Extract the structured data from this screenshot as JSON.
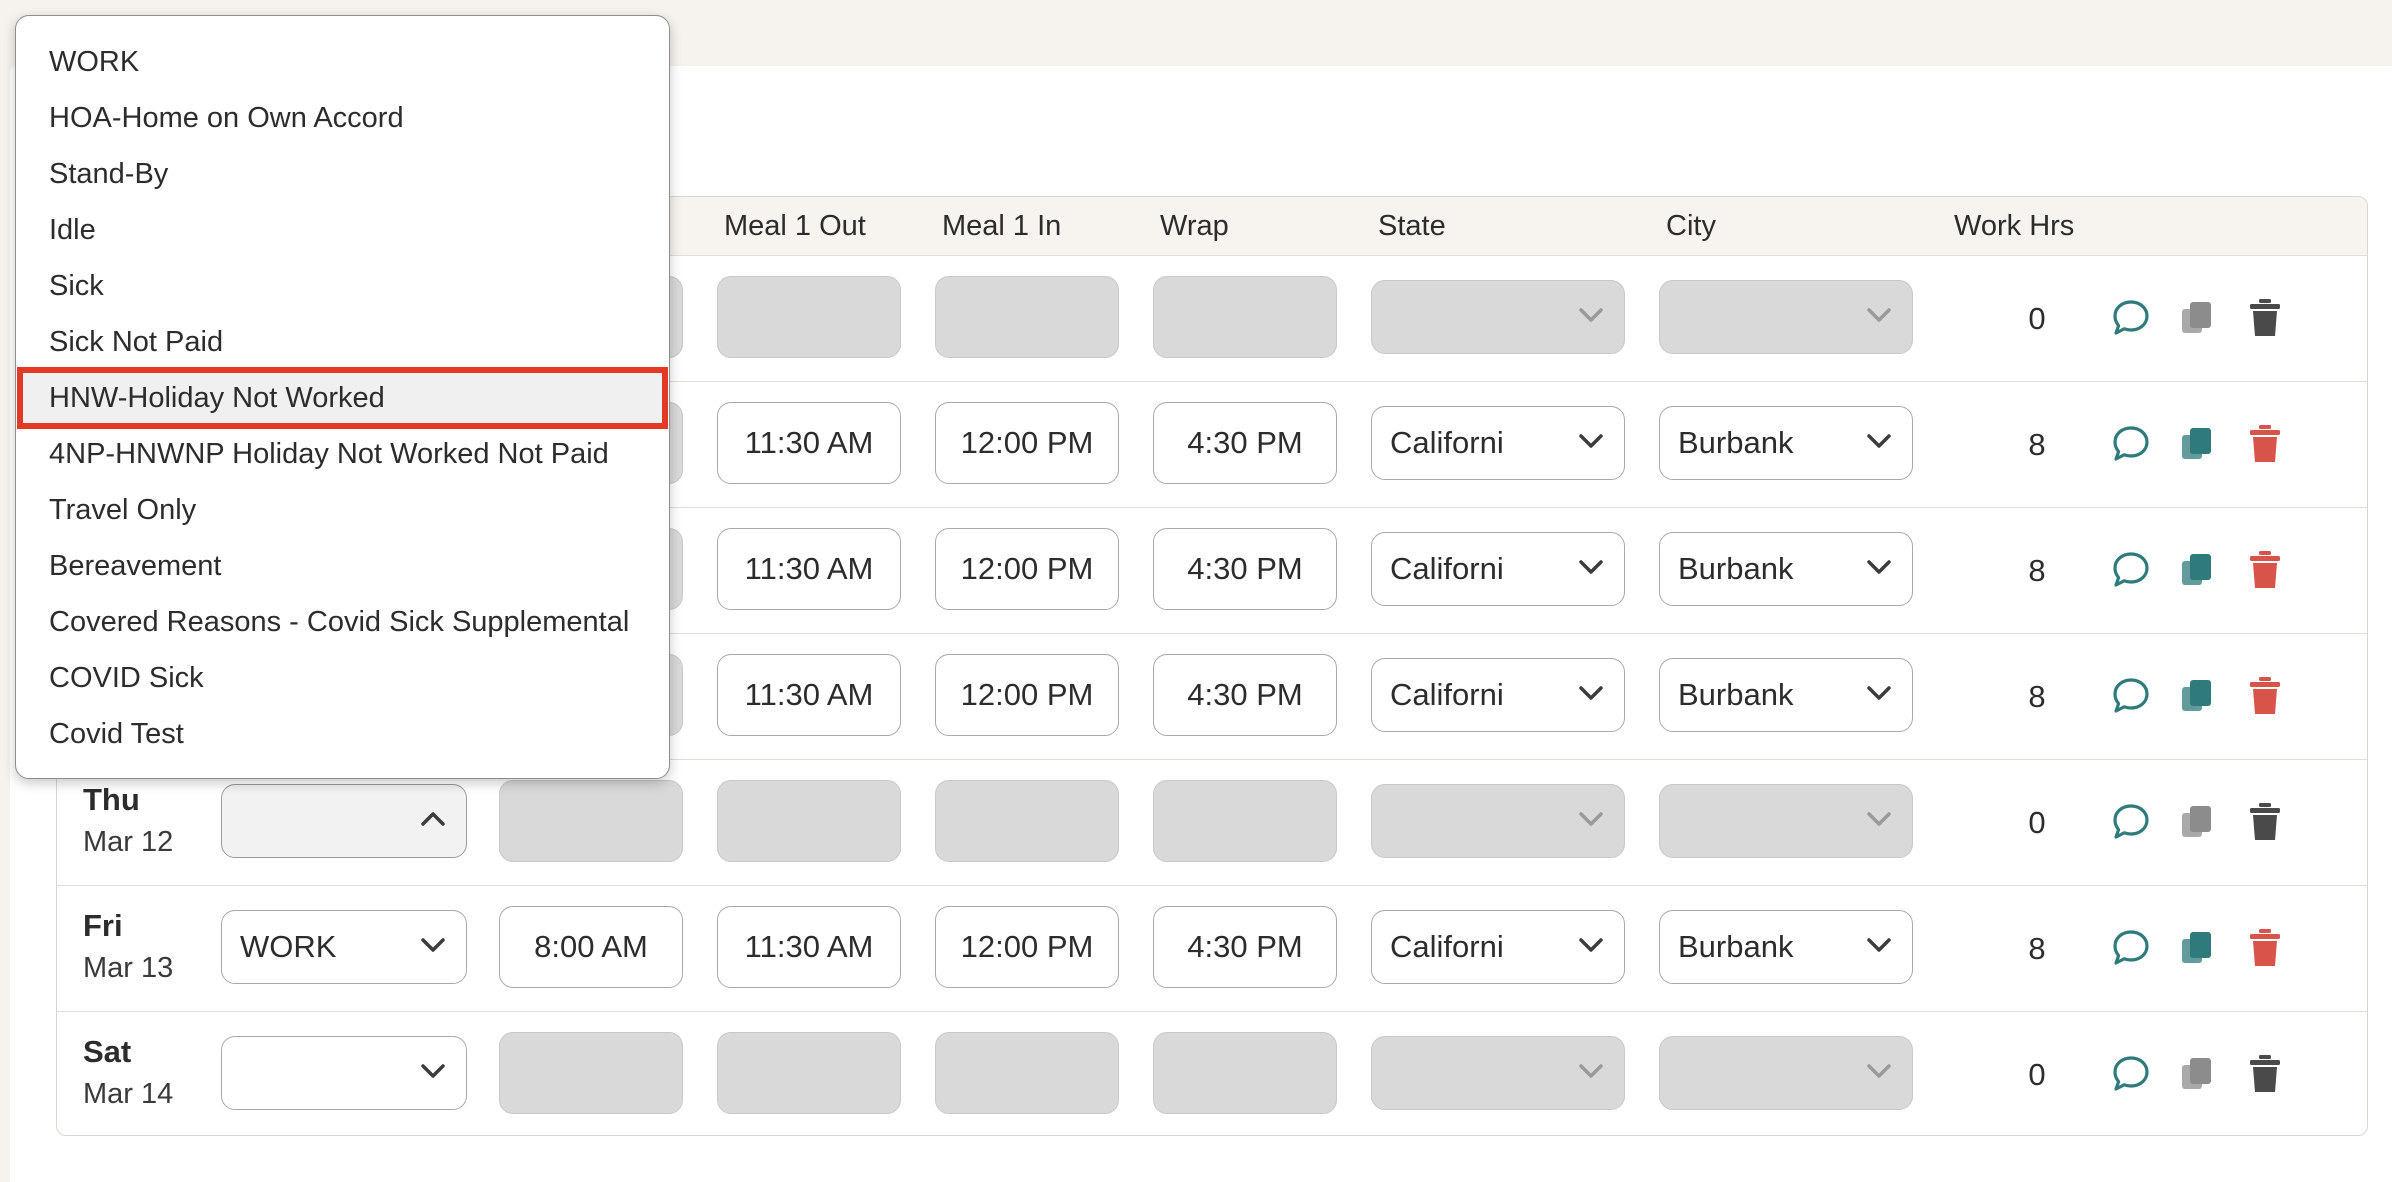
{
  "colors": {
    "accent_teal": "#2f7a7b",
    "delete_red": "#d8544a",
    "highlight_red": "#e23a25",
    "disabled_fill": "#d9d9d9"
  },
  "headers": {
    "meal1_out": "Meal 1 Out",
    "meal1_in": "Meal 1 In",
    "wrap": "Wrap",
    "state": "State",
    "city": "City",
    "work_hrs": "Work Hrs"
  },
  "rows": [
    {
      "day": "",
      "date": "",
      "type": "",
      "call": "",
      "meal1_out": "",
      "meal1_in": "",
      "wrap": "",
      "state": "",
      "city": "",
      "hrs": "0",
      "enabled": false
    },
    {
      "day": "",
      "date": "",
      "type": "",
      "call": "",
      "meal1_out": "11:30 AM",
      "meal1_in": "12:00 PM",
      "wrap": "4:30 PM",
      "state": "Californi",
      "city": "Burbank",
      "hrs": "8",
      "enabled": true
    },
    {
      "day": "",
      "date": "",
      "type": "",
      "call": "",
      "meal1_out": "11:30 AM",
      "meal1_in": "12:00 PM",
      "wrap": "4:30 PM",
      "state": "Californi",
      "city": "Burbank",
      "hrs": "8",
      "enabled": true
    },
    {
      "day": "",
      "date": "",
      "type": "",
      "call": "",
      "meal1_out": "11:30 AM",
      "meal1_in": "12:00 PM",
      "wrap": "4:30 PM",
      "state": "Californi",
      "city": "Burbank",
      "hrs": "8",
      "enabled": true
    },
    {
      "day": "Thu",
      "date": "Mar 12",
      "type": "",
      "call": "",
      "meal1_out": "",
      "meal1_in": "",
      "wrap": "",
      "state": "",
      "city": "",
      "hrs": "0",
      "enabled": false
    },
    {
      "day": "Fri",
      "date": "Mar 13",
      "type": "WORK",
      "call": "8:00 AM",
      "meal1_out": "11:30 AM",
      "meal1_in": "12:00 PM",
      "wrap": "4:30 PM",
      "state": "Californi",
      "city": "Burbank",
      "hrs": "8",
      "enabled": true
    },
    {
      "day": "Sat",
      "date": "Mar 14",
      "type": "",
      "call": "",
      "meal1_out": "",
      "meal1_in": "",
      "wrap": "",
      "state": "",
      "city": "",
      "hrs": "0",
      "enabled": false
    }
  ],
  "dropdown": {
    "selected": "HNW-Holiday Not Worked",
    "options": [
      "WORK",
      "HOA-Home on Own Accord",
      "Stand-By",
      "Idle",
      "Sick",
      "Sick Not Paid",
      "HNW-Holiday Not Worked",
      "4NP-HNWNP Holiday Not Worked Not Paid",
      "Travel Only",
      "Bereavement",
      "Covered Reasons - Covid Sick Supplemental",
      "COVID Sick",
      "Covid Test"
    ]
  },
  "icons": {
    "comment": "speech-bubble-icon",
    "copy": "copy-icon",
    "delete": "trash-icon",
    "chevron_down": "chevron-down-icon",
    "chevron_up": "chevron-up-icon"
  }
}
